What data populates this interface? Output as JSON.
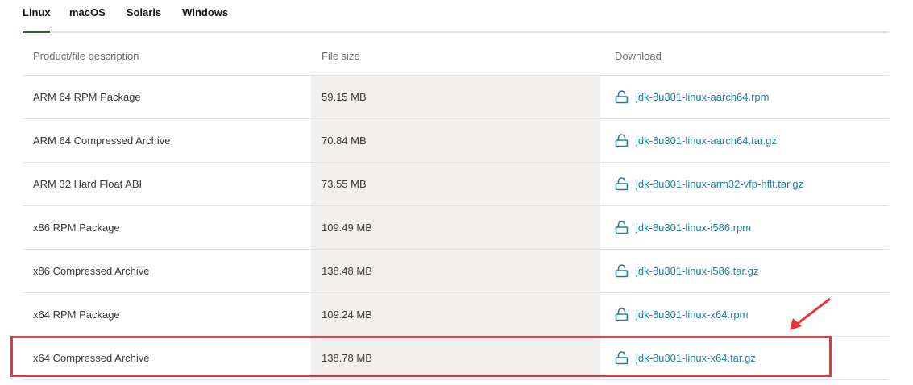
{
  "tabs": [
    {
      "label": "Linux",
      "active": true
    },
    {
      "label": "macOS",
      "active": false
    },
    {
      "label": "Solaris",
      "active": false
    },
    {
      "label": "Windows",
      "active": false
    }
  ],
  "table": {
    "headers": [
      "Product/file description",
      "File size",
      "Download"
    ],
    "rows": [
      {
        "description": "ARM 64 RPM Package",
        "size": "59.15 MB",
        "file": "jdk-8u301-linux-aarch64.rpm"
      },
      {
        "description": "ARM 64 Compressed Archive",
        "size": "70.84 MB",
        "file": "jdk-8u301-linux-aarch64.tar.gz"
      },
      {
        "description": "ARM 32 Hard Float ABI",
        "size": "73.55 MB",
        "file": "jdk-8u301-linux-arm32-vfp-hflt.tar.gz"
      },
      {
        "description": "x86 RPM Package",
        "size": "109.49 MB",
        "file": "jdk-8u301-linux-i586.rpm"
      },
      {
        "description": "x86 Compressed Archive",
        "size": "138.48 MB",
        "file": "jdk-8u301-linux-i586.tar.gz"
      },
      {
        "description": "x64 RPM Package",
        "size": "109.24 MB",
        "file": "jdk-8u301-linux-x64.rpm"
      },
      {
        "description": "x64 Compressed Archive",
        "size": "138.78 MB",
        "file": "jdk-8u301-linux-x64.tar.gz"
      }
    ]
  },
  "icons": {
    "download": "lock-download-icon"
  },
  "colors": {
    "link": "#227e9e",
    "active_tab_underline": "#3c5a3a",
    "highlight": "#e8323c",
    "size_column_bg": "#f1efed"
  }
}
